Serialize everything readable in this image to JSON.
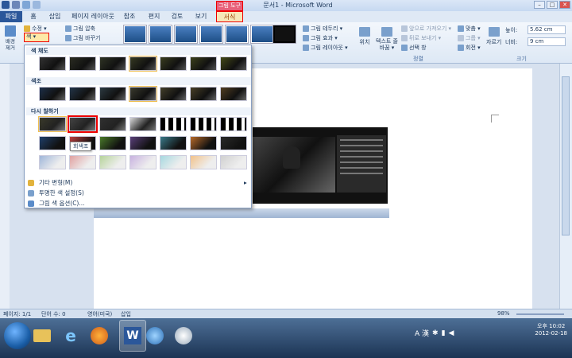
{
  "window": {
    "title": "문서1 - Microsoft Word",
    "context_group": "그림 도구"
  },
  "tabs": [
    {
      "label": "파일"
    },
    {
      "label": "홈"
    },
    {
      "label": "삽입"
    },
    {
      "label": "페이지 레이아웃"
    },
    {
      "label": "참조"
    },
    {
      "label": "편지"
    },
    {
      "label": "검토"
    },
    {
      "label": "보기"
    },
    {
      "label": "서식"
    }
  ],
  "ribbon": {
    "remove_bg": "배경 제거",
    "corrections": "수정 ▾",
    "color": "색 ▾",
    "compress": "그림 압축",
    "change": "그림 바꾸기",
    "border": "그림 테두리 ▾",
    "effects": "그림 효과 ▾",
    "layout": "그림 레이아웃 ▾",
    "position": "위치",
    "wrap": "텍스트 줄 바꿈 ▾",
    "bring_forward": "앞으로 가져오기 ▾",
    "send_backward": "뒤로 보내기 ▾",
    "selection_pane": "선택 창",
    "align": "맞춤 ▾",
    "group": "그룹 ▾",
    "rotate": "회전 ▾",
    "crop": "자르기",
    "height_label": "높이:",
    "height_value": "5.62 cm",
    "width_label": "너비:",
    "width_value": "9 cm",
    "arrange_group": "정렬",
    "size_group": "크기"
  },
  "gallery": {
    "saturation_header": "색 채도",
    "tone_header": "색조",
    "recolor_header": "다시 칠하기",
    "tooltip": "회색조",
    "more_variations": "기타 변형(M)",
    "set_transparent": "투명한 색 설정(S)",
    "color_options": "그림 색 옵션(C)..."
  },
  "statusbar": {
    "page": "페이지: 1/1",
    "words": "단어 수: 0",
    "language": "영어(미국)",
    "insert": "삽입",
    "zoom": "98%"
  },
  "taskbar": {
    "time": "오후 10:02",
    "date": "2012-02-18",
    "lang": "A 漢"
  },
  "colors": {
    "accent": "#2b579a",
    "highlight": "#e00000"
  }
}
